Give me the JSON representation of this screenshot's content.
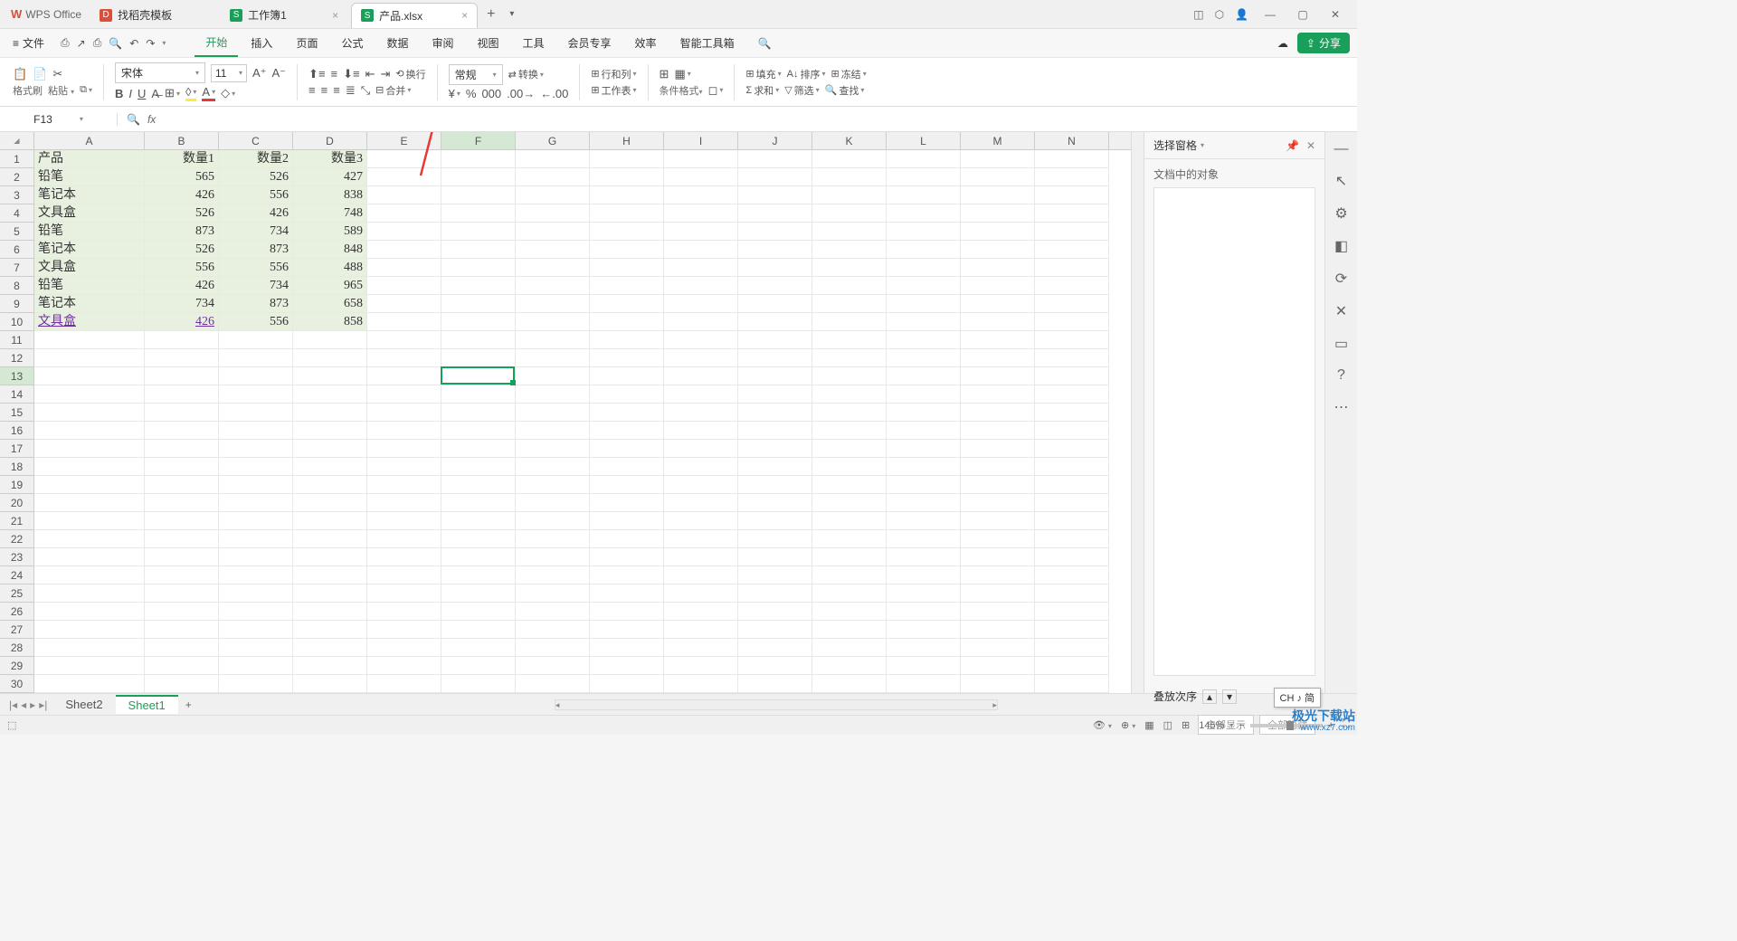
{
  "app": {
    "name": "WPS Office"
  },
  "tabs": [
    {
      "icon": "d",
      "label": "找稻壳模板"
    },
    {
      "icon": "s",
      "label": "工作簿1"
    },
    {
      "icon": "s",
      "label": "产品.xlsx",
      "active": true
    }
  ],
  "window_controls": {
    "min": "—",
    "max": "▢",
    "close": "✕"
  },
  "menubar": {
    "file": "文件",
    "tabs": [
      "开始",
      "插入",
      "页面",
      "公式",
      "数据",
      "审阅",
      "视图",
      "工具",
      "会员专享",
      "效率",
      "智能工具箱"
    ],
    "active_tab": "开始",
    "share": "分享"
  },
  "ribbon": {
    "format_painter": "格式刷",
    "paste": "粘贴",
    "font_name": "宋体",
    "font_size": "11",
    "number_format": "常规",
    "convert": "转换",
    "rows_cols": "行和列",
    "worksheet": "工作表",
    "conditional": "条件格式",
    "merge": "合并",
    "wrap": "换行",
    "fill": "填充",
    "sort": "排序",
    "freeze": "冻结",
    "sum": "求和",
    "filter": "筛选",
    "find": "查找"
  },
  "formula_bar": {
    "name_box": "F13",
    "fx": "fx",
    "value": ""
  },
  "columns": [
    "A",
    "B",
    "C",
    "D",
    "E",
    "F",
    "G",
    "H",
    "I",
    "J",
    "K",
    "L",
    "M",
    "N"
  ],
  "col_widths": {
    "A": 122,
    "default": 82
  },
  "row_count": 30,
  "data_range": {
    "rows": 10,
    "cols": 4
  },
  "spreadsheet": {
    "headers": [
      "产品",
      "数量1",
      "数量2",
      "数量3"
    ],
    "rows": [
      [
        "铅笔",
        565,
        526,
        427
      ],
      [
        "笔记本",
        426,
        556,
        838
      ],
      [
        "文具盒",
        526,
        426,
        748
      ],
      [
        "铅笔",
        873,
        734,
        589
      ],
      [
        "笔记本",
        526,
        873,
        848
      ],
      [
        "文具盒",
        556,
        556,
        488
      ],
      [
        "铅笔",
        426,
        734,
        965
      ],
      [
        "笔记本",
        734,
        873,
        658
      ],
      [
        "文具盒",
        426,
        556,
        858
      ]
    ],
    "link_cells": [
      "A10",
      "B10"
    ]
  },
  "selection": {
    "cell": "F13",
    "col": "F",
    "row": 13
  },
  "right_panel": {
    "title": "选择窗格",
    "subtitle": "文档中的对象",
    "order": "叠放次序",
    "show_all": "全部显示",
    "hide_all": "全部隐藏"
  },
  "sheets": {
    "list": [
      "Sheet2",
      "Sheet1"
    ],
    "active": "Sheet1"
  },
  "statusbar": {
    "zoom": "145%",
    "ime": "CH ♪ 简"
  },
  "watermark": {
    "name": "极光下载站",
    "url": "www.xz7.com"
  }
}
